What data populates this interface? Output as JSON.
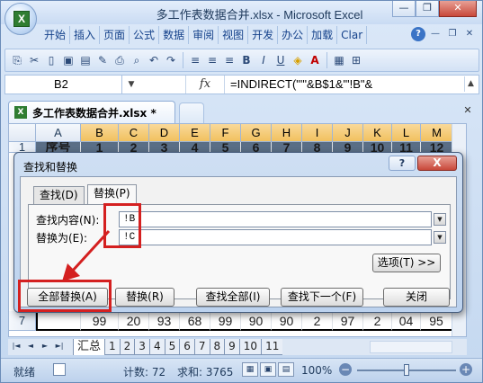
{
  "window": {
    "title": "多工作表数据合并.xlsx - Microsoft Excel",
    "min_icon": "minimize-icon",
    "max_icon": "restore-icon",
    "close_icon": "close-icon"
  },
  "ribbon": {
    "tabs": [
      "开始",
      "插入",
      "页面",
      "公式",
      "数据",
      "审阅",
      "视图",
      "开发",
      "办公",
      "加载",
      "Clar"
    ]
  },
  "formula_bar": {
    "cell_ref": "B2",
    "fx": "fx",
    "formula": "=INDIRECT(\"'\"&B$1&\"'!B\"&"
  },
  "workbook": {
    "tab_name": "多工作表数据合并.xlsx *"
  },
  "grid": {
    "columns": [
      "A",
      "B",
      "C",
      "D",
      "E",
      "F",
      "G",
      "H",
      "I",
      "J",
      "K",
      "L",
      "M"
    ],
    "row1_label": "1",
    "row1_a": "序号",
    "row1_values": [
      "1",
      "2",
      "3",
      "4",
      "5",
      "6",
      "7",
      "8",
      "9",
      "10",
      "11",
      "12"
    ],
    "row7_label": "7",
    "row7_values": [
      "99",
      "20",
      "93",
      "68",
      "99",
      "90",
      "90",
      "2",
      "97",
      "2",
      "04",
      "95"
    ]
  },
  "sheets": {
    "nav": [
      "|◄",
      "◄",
      "►",
      "►|"
    ],
    "tabs": [
      "汇总",
      "1",
      "2",
      "3",
      "4",
      "5",
      "6",
      "7",
      "8",
      "9",
      "10",
      "11"
    ]
  },
  "status": {
    "ready": "就绪",
    "count": "计数: 72",
    "sum": "求和: 3765",
    "zoom": "100%",
    "zoom_level": 1.0
  },
  "dialog": {
    "title": "查找和替换",
    "help": "?",
    "close": "X",
    "tab_find": "查找(D)",
    "tab_replace": "替换(P)",
    "find_label": "查找内容(N):",
    "find_value": "!B",
    "replace_label": "替换为(E):",
    "replace_value": "!C",
    "options_btn": "选项(T) >>",
    "btn_replace_all": "全部替换(A)",
    "btn_replace": "替换(R)",
    "btn_find_all": "查找全部(I)",
    "btn_find_next": "查找下一个(F)",
    "btn_close": "关闭"
  },
  "colors": {
    "highlight": "#d42020",
    "header_selected": "#f1c15f"
  }
}
